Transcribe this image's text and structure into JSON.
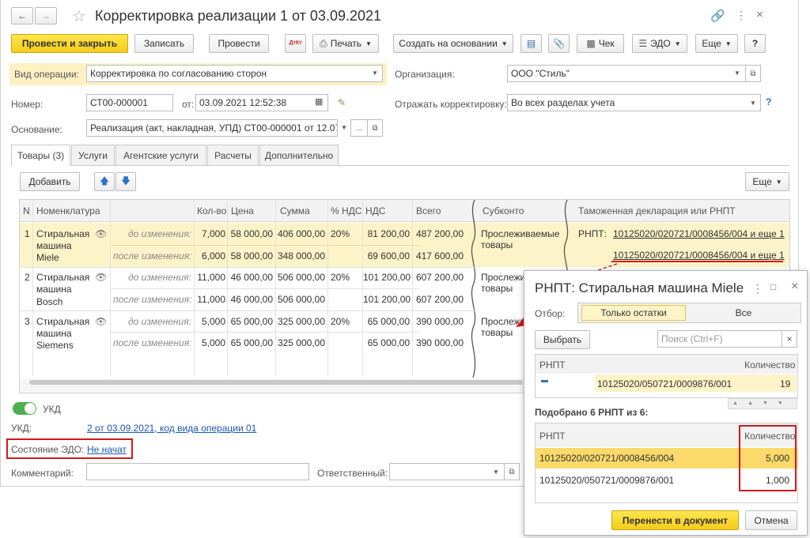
{
  "window": {
    "title": "Корректировка реализации 1 от 03.09.2021"
  },
  "toolbar": {
    "post_close": "Провести и закрыть",
    "save": "Записать",
    "post": "Провести",
    "dt_kt": "ДтКт",
    "print": "Печать",
    "create_based": "Создать на основании",
    "attach_icon": "paperclip-icon",
    "check": "Чек",
    "edo": "ЭДО",
    "more": "Еще",
    "help": "?"
  },
  "form": {
    "op_type_label": "Вид операции:",
    "op_type_value": "Корректировка по согласованию сторон",
    "org_label": "Организация:",
    "org_value": "ООО \"Стиль\"",
    "number_label": "Номер:",
    "number_value": "СТ00-000001",
    "date_from_label": "от:",
    "date_value": "03.09.2021 12:52:38",
    "reflect_label": "Отражать корректировку:",
    "reflect_value": "Во всех разделах учета",
    "reflect_help": "?",
    "basis_label": "Основание:",
    "basis_value": "Реализация (акт, накладная, УПД) СТ00-000001 от 12.07."
  },
  "tabs": [
    "Товары (3)",
    "Услуги",
    "Агентские услуги",
    "Расчеты",
    "Дополнительно"
  ],
  "table_toolbar": {
    "add": "Добавить",
    "more": "Еще"
  },
  "table": {
    "headers": {
      "n": "N",
      "nom": "Номенклатура",
      "qty": "Кол-во",
      "price": "Цена",
      "sum": "Сумма",
      "vat_rate": "% НДС",
      "vat": "НДС",
      "total": "Всего",
      "subkonto": "Субконто",
      "customs": "Таможенная декларация или РНПТ"
    },
    "rows": [
      {
        "n": "1",
        "name1": "Стиральная",
        "name2": "машина",
        "name3": "Miele",
        "before": "до изменения:",
        "after": "после изменения:",
        "b_qty": "7,000",
        "b_price": "58 000,00",
        "b_sum": "406 000,00",
        "b_rate": "20%",
        "b_vat": "81 200,00",
        "b_total": "487 200,00",
        "a_qty": "6,000",
        "a_price": "58 000,00",
        "a_sum": "348 000,00",
        "a_vat": "69 600,00",
        "a_total": "417 600,00",
        "sub1": "Прослеживаемые",
        "sub2": "товары",
        "rnpt_label": "РНПТ:",
        "rnpt1": "10125020/020721/0008456/004 и еще 1",
        "rnpt2": "10125020/020721/0008456/004 и еще 1"
      },
      {
        "n": "2",
        "name1": "Стиральная",
        "name2": "машина",
        "name3": "Bosch",
        "before": "до изменения:",
        "after": "после изменения:",
        "b_qty": "11,000",
        "b_price": "46 000,00",
        "b_sum": "506 000,00",
        "b_rate": "20%",
        "b_vat": "101 200,00",
        "b_total": "607 200,00",
        "a_qty": "11,000",
        "a_price": "46 000,00",
        "a_sum": "506 000,00",
        "a_vat": "101 200,00",
        "a_total": "607 200,00",
        "sub1": "Прослежи",
        "sub2": "товары"
      },
      {
        "n": "3",
        "name1": "Стиральная",
        "name2": "машина",
        "name3": "Siemens",
        "before": "до изменения:",
        "after": "после изменения:",
        "b_qty": "5,000",
        "b_price": "65 000,00",
        "b_sum": "325 000,00",
        "b_rate": "20%",
        "b_vat": "65 000,00",
        "b_total": "390 000,00",
        "a_qty": "5,000",
        "a_price": "65 000,00",
        "a_sum": "325 000,00",
        "a_vat": "65 000,00",
        "a_total": "390 000,00",
        "sub1": "Прослежи",
        "sub2": "товары"
      }
    ]
  },
  "bottom": {
    "ukd_toggle": "УКД",
    "ukd_label": "УКД:",
    "ukd_link": "2 от 03.09.2021, код вида операции 01",
    "edo_label": "Состояние ЭДО:",
    "edo_link": "Не начат",
    "comment_label": "Комментарий:",
    "responsible_label": "Ответственный:"
  },
  "popup": {
    "title": "РНПТ: Стиральная машина Miele",
    "filter_label": "Отбор:",
    "filter_only": "Только остатки",
    "filter_all": "Все",
    "select": "Выбрать",
    "search_placeholder": "Поиск (Ctrl+F)",
    "col_rnpt": "РНПТ",
    "col_qty": "Количество",
    "avail_rows": [
      {
        "rnpt": "10125020/050721/0009876/001",
        "qty": "19"
      }
    ],
    "picked_label": "Подобрано 6 РНПТ из 6:",
    "picked_rows": [
      {
        "rnpt": "10125020/020721/0008456/004",
        "qty": "5,000"
      },
      {
        "rnpt": "10125020/050721/0009876/001",
        "qty": "1,000"
      }
    ],
    "transfer": "Перенести в документ",
    "cancel": "Отмена"
  },
  "colors": {
    "accent_yellow": "#f5cc1a",
    "highlight_row": "#fdf3c8",
    "link": "#1a57b8",
    "red_frame": "#d11a1a"
  }
}
